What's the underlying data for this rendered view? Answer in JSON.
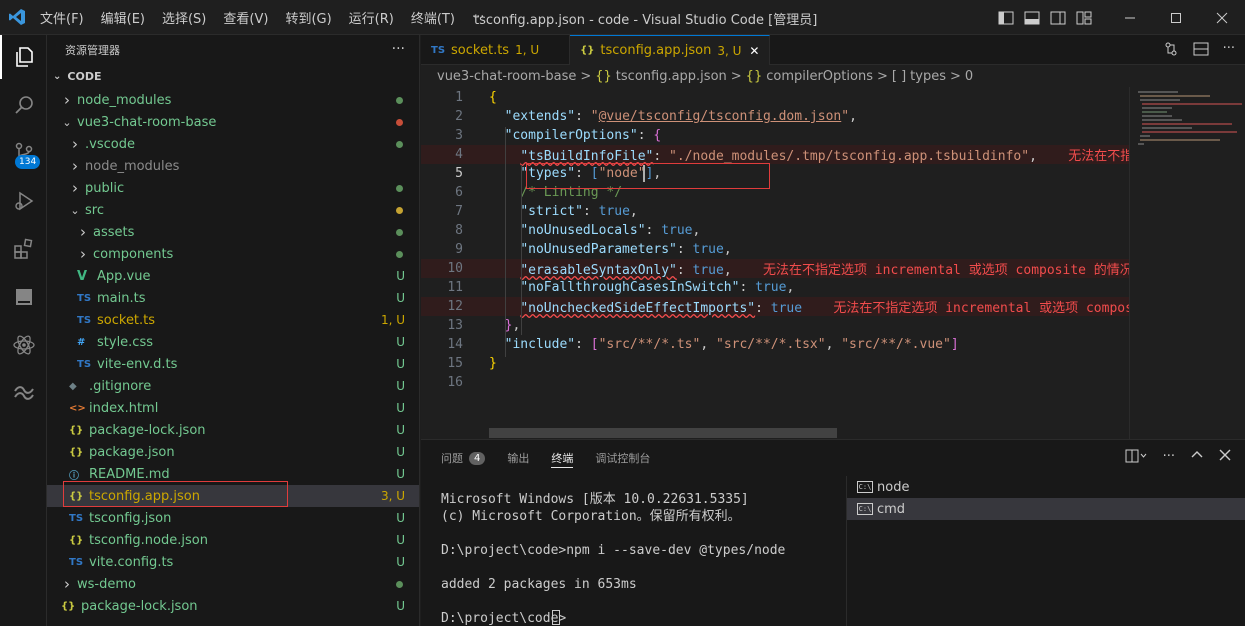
{
  "window": {
    "title": "tsconfig.app.json - code - Visual Studio Code [管理员]",
    "menu": [
      "文件(F)",
      "编辑(E)",
      "选择(S)",
      "查看(V)",
      "转到(G)",
      "运行(R)",
      "终端(T)",
      "···"
    ]
  },
  "activity": {
    "scm_badge": "134"
  },
  "sidebar": {
    "header": "资源管理器",
    "more": "···",
    "section": "CODE",
    "items": [
      {
        "label": "node_modules",
        "icon": "folder-chevron",
        "status": "",
        "dot": "#5b8f5b"
      },
      {
        "label": "vue3-chat-room-base",
        "icon": "folder-open",
        "status": "",
        "dot": "#c74e39"
      },
      {
        "label": ".vscode",
        "icon": "folder-chevron",
        "status": "",
        "dot": "#5b8f5b"
      },
      {
        "label": "node_modules",
        "icon": "folder-chevron",
        "status": "",
        "dot": ""
      },
      {
        "label": "public",
        "icon": "folder-chevron",
        "status": "",
        "dot": "#5b8f5b"
      },
      {
        "label": "src",
        "icon": "folder-open",
        "status": "",
        "dot": "#c5a332"
      },
      {
        "label": "assets",
        "icon": "folder-chevron",
        "status": "",
        "dot": "#5b8f5b"
      },
      {
        "label": "components",
        "icon": "folder-chevron",
        "status": "",
        "dot": "#5b8f5b"
      },
      {
        "label": "App.vue",
        "icon": "V",
        "status": "U",
        "dot": ""
      },
      {
        "label": "main.ts",
        "icon": "TS",
        "status": "U",
        "dot": ""
      },
      {
        "label": "socket.ts",
        "icon": "TS",
        "status": "1, U",
        "dot": ""
      },
      {
        "label": "style.css",
        "icon": "#",
        "status": "U",
        "dot": ""
      },
      {
        "label": "vite-env.d.ts",
        "icon": "TS",
        "status": "U",
        "dot": ""
      },
      {
        "label": ".gitignore",
        "icon": "◆",
        "status": "U",
        "dot": ""
      },
      {
        "label": "index.html",
        "icon": "<>",
        "status": "U",
        "dot": ""
      },
      {
        "label": "package-lock.json",
        "icon": "{}",
        "status": "U",
        "dot": ""
      },
      {
        "label": "package.json",
        "icon": "{}",
        "status": "U",
        "dot": ""
      },
      {
        "label": "README.md",
        "icon": "ⓘ",
        "status": "U",
        "dot": ""
      },
      {
        "label": "tsconfig.app.json",
        "icon": "{}",
        "status": "3, U",
        "dot": ""
      },
      {
        "label": "tsconfig.json",
        "icon": "TS",
        "status": "U",
        "dot": ""
      },
      {
        "label": "tsconfig.node.json",
        "icon": "{}",
        "status": "U",
        "dot": ""
      },
      {
        "label": "vite.config.ts",
        "icon": "TS",
        "status": "U",
        "dot": ""
      },
      {
        "label": "ws-demo",
        "icon": "folder-chevron",
        "status": "",
        "dot": "#5b8f5b"
      },
      {
        "label": "package-lock.json",
        "icon": "{}",
        "status": "U",
        "dot": ""
      }
    ]
  },
  "editor": {
    "tabs": [
      {
        "icon": "TS",
        "label": "socket.ts",
        "meta": "1, U",
        "active": false
      },
      {
        "icon": "{}",
        "label": "tsconfig.app.json",
        "meta": "3, U",
        "active": true
      }
    ],
    "breadcrumb": [
      "vue3-chat-room-base",
      ">",
      "{}",
      "tsconfig.app.json",
      ">",
      "{}",
      "compilerOptions",
      ">",
      "[ ]",
      "types",
      ">",
      "0"
    ],
    "lines": [
      {
        "n": "1",
        "html": "<span class='y'>{</span>"
      },
      {
        "n": "2",
        "html": "  <span class='k'>\"extends\"</span><span class='p'>: </span><span class='s'>\"<u>@vue/tsconfig/tsconfig.dom.json</u>\"</span><span class='p'>,</span>"
      },
      {
        "n": "3",
        "html": "  <span class='k'>\"compilerOptions\"</span><span class='p'>: </span><span class='m'>{</span>"
      },
      {
        "n": "4",
        "html": "    <span class='k sq'>\"tsBuildInfoFile\"</span><span class='p'>: </span><span class='s'>\"./node_modules/.tmp/tsconfig.app.tsbuildinfo\"</span><span class='p'>,    </span><span class='err'>无法在不指定选项 incremental 或选项 composite 的情况下指定选项 tsBuildInfoFile</span>",
        "err": true
      },
      {
        "n": "5",
        "html": "    <span class='k'>\"types\"</span><span class='p'>: </span><span class='b'>[</span><span class='s'>\"node\"</span><span class='b'>]</span><span class='p'>,</span>"
      },
      {
        "n": "6",
        "html": "    <span class='c'>/* Linting */</span>"
      },
      {
        "n": "7",
        "html": "    <span class='k'>\"strict\"</span><span class='p'>: </span><span class='b'>true</span><span class='p'>,</span>"
      },
      {
        "n": "8",
        "html": "    <span class='k'>\"noUnusedLocals\"</span><span class='p'>: </span><span class='b'>true</span><span class='p'>,</span>"
      },
      {
        "n": "9",
        "html": "    <span class='k'>\"noUnusedParameters\"</span><span class='p'>: </span><span class='b'>true</span><span class='p'>,</span>"
      },
      {
        "n": "10",
        "html": "    <span class='k sq'>\"erasableSyntaxOnly\"</span><span class='p'>: </span><span class='b'>true</span><span class='p'>,    </span><span class='err'>无法在不指定选项 incremental 或选项 composite 的情况下</span>",
        "err": true
      },
      {
        "n": "11",
        "html": "    <span class='k'>\"noFallthroughCasesInSwitch\"</span><span class='p'>: </span><span class='b'>true</span><span class='p'>,</span>"
      },
      {
        "n": "12",
        "html": "    <span class='k sq'>\"noUncheckedSideEffectImports\"</span><span class='p'>: </span><span class='b'>true</span><span class='p'>    </span><span class='err'>无法在不指定选项 incremental 或选项 composite</span>",
        "err": true
      },
      {
        "n": "13",
        "html": "  <span class='m'>}</span><span class='p'>,</span>"
      },
      {
        "n": "14",
        "html": "  <span class='k'>\"include\"</span><span class='p'>: </span><span class='m'>[</span><span class='s'>\"src/**/*.ts\"</span><span class='p'>, </span><span class='s'>\"src/**/*.tsx\"</span><span class='p'>, </span><span class='s'>\"src/**/*.vue\"</span><span class='m'>]</span>"
      },
      {
        "n": "15",
        "html": "<span class='y'>}</span>"
      },
      {
        "n": "16",
        "html": ""
      }
    ]
  },
  "panel": {
    "tabs": [
      {
        "label": "问题",
        "count": "4",
        "active": false
      },
      {
        "label": "输出",
        "count": "",
        "active": false
      },
      {
        "label": "终端",
        "count": "",
        "active": true
      },
      {
        "label": "调试控制台",
        "count": "",
        "active": false
      }
    ],
    "terminal": "Microsoft Windows [版本 10.0.22631.5335]\n(c) Microsoft Corporation。保留所有权利。\n\nD:\\project\\code>npm i --save-dev @types/node\n\nadded 2 packages in 653ms\n\nD:\\project\\code>",
    "terminals": [
      {
        "label": "node",
        "selected": false
      },
      {
        "label": "cmd",
        "selected": true
      }
    ]
  }
}
